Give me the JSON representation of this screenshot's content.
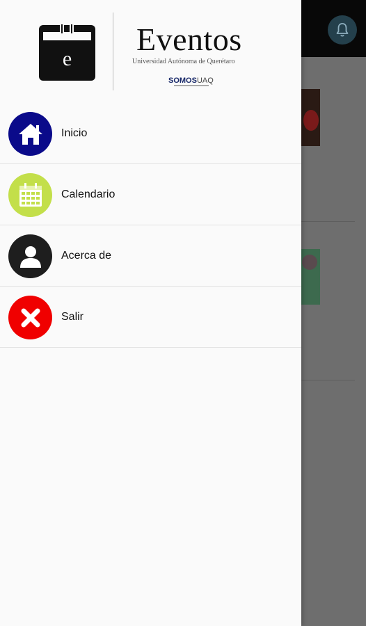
{
  "app": {
    "brand_title": "Eventos",
    "brand_subtitle": "Universidad Autónoma de Querétaro",
    "brand_somos_bold": "SOMOS",
    "brand_somos_rest": "UAQ",
    "logo_letter": "e"
  },
  "drawer": {
    "items": [
      {
        "label": "Inicio",
        "icon": "home-icon",
        "color": "#0a0a8a"
      },
      {
        "label": "Calendario",
        "icon": "calendar-icon",
        "color": "#c3df4a"
      },
      {
        "label": "Acerca de",
        "icon": "user-icon",
        "color": "#1e1e1e"
      },
      {
        "label": "Salir",
        "icon": "close-icon",
        "color": "#f00000"
      }
    ]
  },
  "background": {
    "topbar_icon": "bell-icon"
  }
}
